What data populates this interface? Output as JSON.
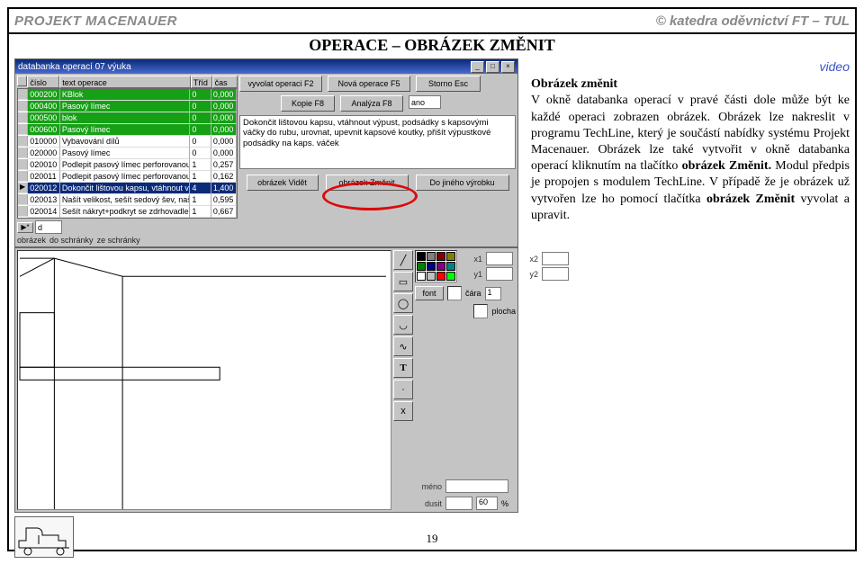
{
  "header": {
    "left": "PROJEKT MACENAUER",
    "right": "© katedra oděvnictví FT – TUL"
  },
  "title": "OPERACE – OBRÁZEK ZMĚNIT",
  "video_link": "video",
  "paragraph": {
    "heading": "Obrázek změnit",
    "body": "V okně databanka operací v pravé části dole může být ke každé operaci zobrazen obrázek. Obrázek lze nakreslit v programu TechLine, který je součástí nabídky systému Projekt Macenauer. Obrázek lze také vytvořit v okně databanka operací kliknutím na tlačítko ",
    "bold1": "obrázek Změnit. ",
    "body2": "Modul předpis je propojen s modulem TechLine. V případě že je obrázek už vytvořen lze ho pomocí tlačítka ",
    "bold2": "obrázek Změnit",
    "body3": " vyvolat a upravit."
  },
  "page_num": "19",
  "win1": {
    "title": "databanka operací 07 výuka",
    "head": {
      "c1": "číslo",
      "c2": "text operace",
      "c3": "Tříd",
      "c4": "čas"
    },
    "rows": [
      {
        "c1": "000200",
        "c2": "KBlok",
        "c3": "0",
        "c4": "0,000",
        "green": true
      },
      {
        "c1": "000400",
        "c2": "Pasový límec",
        "c3": "0",
        "c4": "0,000",
        "green": true
      },
      {
        "c1": "000500",
        "c2": "blok",
        "c3": "0",
        "c4": "0,000",
        "green": true
      },
      {
        "c1": "000600",
        "c2": "Pasový límec",
        "c3": "0",
        "c4": "0,000",
        "green": true
      },
      {
        "c1": "010000",
        "c2": "Vybavování dílů",
        "c3": "0",
        "c4": "0,000"
      },
      {
        "c1": "020000",
        "c2": "Pasový límec",
        "c3": "0",
        "c4": "0,000"
      },
      {
        "c1": "020010",
        "c2": "Podlepit pasový límec perforovanou vložkou",
        "c3": "1",
        "c4": "0,257"
      },
      {
        "c1": "020011",
        "c2": "Podlepit pasový límec perforovanou vložkou",
        "c3": "1",
        "c4": "0,162"
      },
      {
        "c1": "020012",
        "c2": "Dokončit lištovou kapsu, vtáhnout výpust, podsádky",
        "c3": "4",
        "c4": "1,400",
        "sel": true
      },
      {
        "c1": "020013",
        "c2": "Našít velikost, sešít sedový šev, našít tkanici zd.",
        "c3": "1",
        "c4": "0,595"
      },
      {
        "c1": "020014",
        "c2": "Sešít nákryt+podkryt se zdrhovadlem",
        "c3": "1",
        "c4": "0,667"
      }
    ],
    "filter_char": "d",
    "footer_labels": {
      "a": "obrázek",
      "b": "do schránky",
      "c": "ze schránky"
    }
  },
  "panel_right": {
    "btn_vyvolat": "vyvolat operaci F2",
    "btn_nova": "Nová operace F5",
    "btn_storno": "Storno Esc",
    "btn_kopie": "Kopie F8",
    "btn_analyza": "Analýza F8",
    "field_ano": "ano",
    "desc": "Dokončit lištovou kapsu, vtáhnout výpust, podsádky s kapsovými váčky do rubu, urovnat, upevnit kapsové koutky, přišít výpustkové podsádky na kaps. váček",
    "btn_videt": "obrázek Vidět",
    "btn_zmenit": "obrázek Změnit",
    "btn_jineho": "Do jiného výrobku"
  },
  "editor": {
    "side": {
      "x1": "x1",
      "x2": "x2",
      "y1": "y1",
      "y2": "y2",
      "font": "font",
      "cara": "čára",
      "cara_val": "1",
      "plocha": "plocha",
      "meno": "méno",
      "dusit": "dusit",
      "percent": "60",
      "pct": "%"
    },
    "palette": [
      "#000",
      "#808080",
      "#800000",
      "#808000",
      "#008000",
      "#000080",
      "#800080",
      "#008080",
      "#fff",
      "#c0c0c0",
      "#ff0000",
      "#00ff00"
    ]
  }
}
